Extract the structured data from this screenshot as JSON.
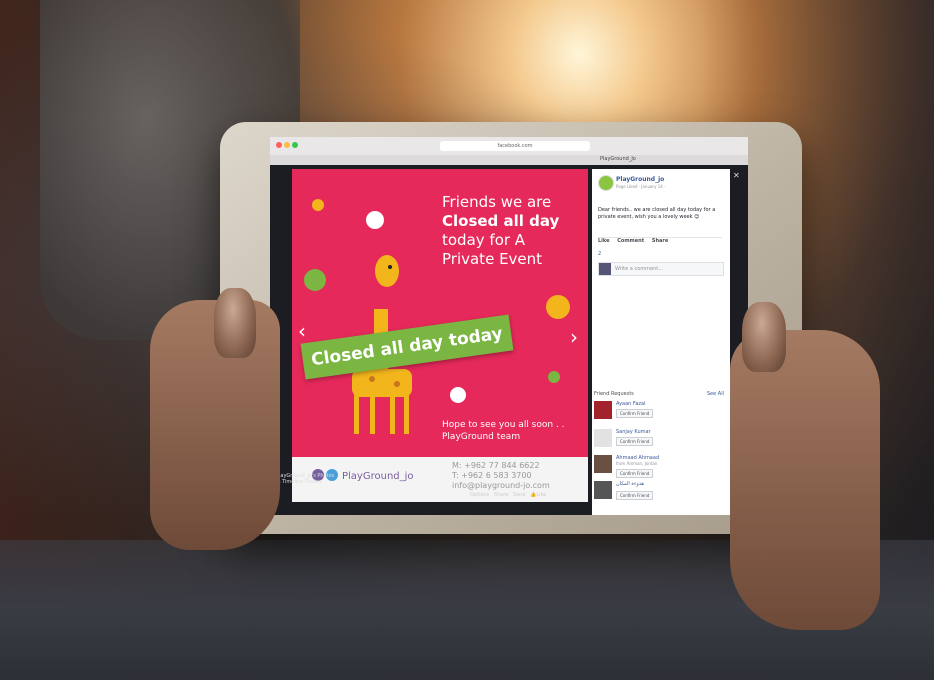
{
  "browser": {
    "url": "facebook.com",
    "tab_title": "PlayGround_Jo"
  },
  "photo": {
    "headline_line1": "Friends we are",
    "headline_line2": "Closed all day",
    "headline_line3": "today for A",
    "headline_line4": "Private Event",
    "sign_text": "Closed all day today",
    "footer_line1": "Hope to see you all soon . .",
    "footer_line2": "PlayGround team",
    "contact_phone_mobile": "M: +962 77 844 6622",
    "contact_phone_tel": "T: +962 6 583 3700",
    "contact_email": "info@playground-jo.com",
    "brand_name": "PlayGround_jo"
  },
  "viewer": {
    "caption_line1": "PlayGround_Jo's Photos",
    "caption_line2": "in Timeline Photos",
    "action_options": "Options",
    "action_share": "Share",
    "action_send": "Send",
    "action_like": "Like"
  },
  "post": {
    "page_name": "PlayGround_jo",
    "page_meta": "Page Liked · January 14 ·",
    "text": "Dear friends.. we are closed all day today for a private event, wish you a lovely week 😊",
    "like_label": "Like",
    "comment_label": "Comment",
    "share_label": "Share",
    "likes_count": "2",
    "comment_placeholder": "Write a comment..."
  },
  "friend_requests": {
    "title": "Friend Requests",
    "see_all": "See All",
    "items": [
      {
        "name": "Ayaan Fazal",
        "sub": "",
        "button": "Confirm Friend"
      },
      {
        "name": "Sanjay Kumar",
        "sub": "",
        "button": "Confirm Friend"
      },
      {
        "name": "Ahmaad Ahmaad",
        "sub": "from Amman, Jordan",
        "button": "Confirm Friend"
      },
      {
        "name": "هدوءة المكان",
        "sub": "",
        "button": "Confirm Friend"
      }
    ]
  },
  "colors": {
    "photo_background": "#e5295a",
    "sign_green": "#7ab641",
    "facebook_blue": "#3b5998"
  }
}
